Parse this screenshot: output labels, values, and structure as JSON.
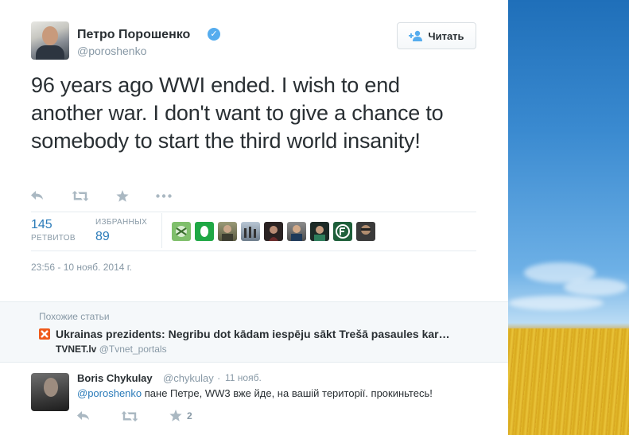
{
  "tweet": {
    "author_name": "Петро Порошенко",
    "author_handle": "@poroshenko",
    "verified": true,
    "follow_label": "Читать",
    "text": "96 years ago WWI ended. I wish to end another war. I don't want to give a chance to somebody to start the third world insanity!",
    "actions": [
      "reply-icon",
      "retweet-icon",
      "favorite-icon",
      "more-icon"
    ],
    "retweets": {
      "count": "145",
      "label": "РЕТВИТОВ"
    },
    "favorites": {
      "count": "89",
      "label": "ИЗБРАННЫХ"
    },
    "timestamp": "23:56 - 10 нояб. 2014 г."
  },
  "related": {
    "header": "Похожие статьи",
    "title": "Ukrainas prezidents: Negribu dot kādam iespēju sākt Trešā pasaules kar…",
    "source_site": "TVNET.lv",
    "source_handle": "@Tvnet_portals"
  },
  "reply": {
    "name": "Boris Chykulay",
    "handle": "@chykulay",
    "separator": "·",
    "time": "11 нояб.",
    "mention": "@poroshenko",
    "text": " пане Петре, WW3 вже йде, на вашій території. прокиньтесь!",
    "favorite_count": "2"
  },
  "colors": {
    "link": "#2b7bb9",
    "muted": "#8899a6",
    "verified": "#55acee",
    "icon": "#aab8c2"
  }
}
